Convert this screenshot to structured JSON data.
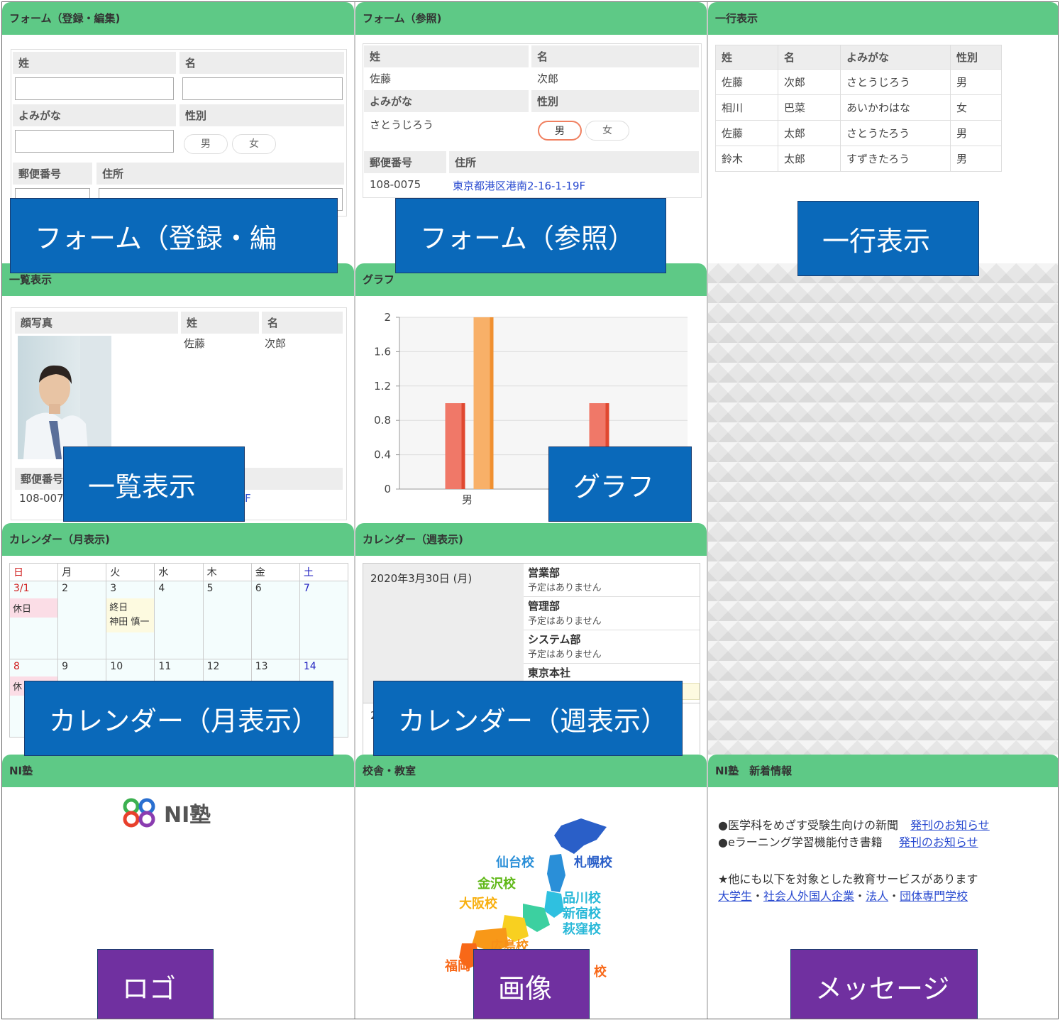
{
  "panels": {
    "form_edit": {
      "title": "フォーム（登録・編集)",
      "label_sei": "姓",
      "label_mei": "名",
      "label_yomigana": "よみがな",
      "label_seibetsu": "性別",
      "gender_male": "男",
      "gender_female": "女",
      "label_yubin": "郵便番号",
      "label_jusho": "住所"
    },
    "form_view": {
      "title": "フォーム（参照)",
      "label_sei": "姓",
      "label_mei": "名",
      "value_sei": "佐藤",
      "value_mei": "次郎",
      "label_yomigana": "よみがな",
      "label_seibetsu": "性別",
      "value_yomigana": "さとうじろう",
      "gender_male": "男",
      "gender_female": "女",
      "label_yubin": "郵便番号",
      "label_jusho": "住所",
      "value_yubin": "108-0075",
      "value_jusho": "東京都港区港南2-16-1-19F"
    },
    "row_view": {
      "title": "一行表示",
      "headers": [
        "姓",
        "名",
        "よみがな",
        "性別"
      ],
      "rows": [
        [
          "佐藤",
          "次郎",
          "さとうじろう",
          "男"
        ],
        [
          "相川",
          "巴菜",
          "あいかわはな",
          "女"
        ],
        [
          "佐藤",
          "太郎",
          "さとうたろう",
          "男"
        ],
        [
          "鈴木",
          "太郎",
          "すずきたろう",
          "男"
        ]
      ]
    },
    "list_view": {
      "title": "一覧表示",
      "label_photo": "顔写真",
      "label_sei": "姓",
      "label_mei": "名",
      "value_sei": "佐藤",
      "value_mei": "次郎",
      "label_yubin": "郵便番号",
      "value_yubin": "108-007",
      "value_jusho_tail": "F"
    },
    "graph": {
      "title": "グラフ"
    },
    "cal_month": {
      "title": "カレンダー（月表示)",
      "weekdays": [
        "日",
        "月",
        "火",
        "水",
        "木",
        "金",
        "土"
      ],
      "week1": [
        "3/1",
        "2",
        "3",
        "4",
        "5",
        "6",
        "7"
      ],
      "week2": [
        "8",
        "9",
        "10",
        "11",
        "12",
        "13",
        "14"
      ],
      "holiday": "休日",
      "holiday_cut": "休",
      "allday": "終日",
      "person": "神田 慎一"
    },
    "cal_week": {
      "title": "カレンダー（週表示)",
      "date": "2020年3月30日 (月)",
      "next_date_cut": "2",
      "depts": [
        "営業部",
        "管理部",
        "システム部",
        "東京本社"
      ],
      "no_schedule": "予定はありません"
    },
    "logo": {
      "title": "NI塾",
      "logo_text": "NI塾"
    },
    "image": {
      "title": "校舎・教室",
      "campuses": {
        "sendai": "仙台校",
        "sapporo": "札幌校",
        "kanazawa": "金沢校",
        "shinagawa": "品川校",
        "shinjuku": "新宿校",
        "ogikubo": "萩窪校",
        "osaka": "大阪校",
        "hiroshima": "広島校",
        "fukuoka": "福岡",
        "cut": "校"
      }
    },
    "news": {
      "title": "NI塾　新着情報",
      "item1": "●医学科をめざす受験生向けの新聞",
      "item2": "●eラーニング学習機能付き書籍",
      "link_label": "発刊のお知らせ",
      "services": "★他にも以下を対象とした教育サービスがあります",
      "service_links": [
        "大学生",
        "社会人外国人企業",
        "法人",
        "団体専門学校"
      ],
      "dot": "・"
    }
  },
  "overlays": {
    "form_edit": "フォーム（登録・編",
    "form_view": "フォーム（参照）",
    "row_view": "一行表示",
    "list_view": "一覧表示",
    "graph": "グラフ",
    "cal_month": "カレンダー（月表示）",
    "cal_week": "カレンダー（週表示）",
    "logo": "ロゴ",
    "image": "画像",
    "message": "メッセージ"
  },
  "colors": {
    "header_green": "#5ec986",
    "overlay_blue": "#0a69ba",
    "overlay_purple": "#7030a0",
    "bar_red": "#f07868",
    "bar_orange": "#f8b068"
  },
  "chart_data": {
    "type": "bar",
    "categories": [
      "男",
      ""
    ],
    "series": [
      {
        "values": [
          1,
          1
        ]
      },
      {
        "values": [
          2,
          null
        ]
      }
    ],
    "ylim": [
      0,
      2
    ],
    "yticks": [
      "0",
      "0.4",
      "0.8",
      "1.2",
      "1.6",
      "2"
    ],
    "grid": true
  }
}
